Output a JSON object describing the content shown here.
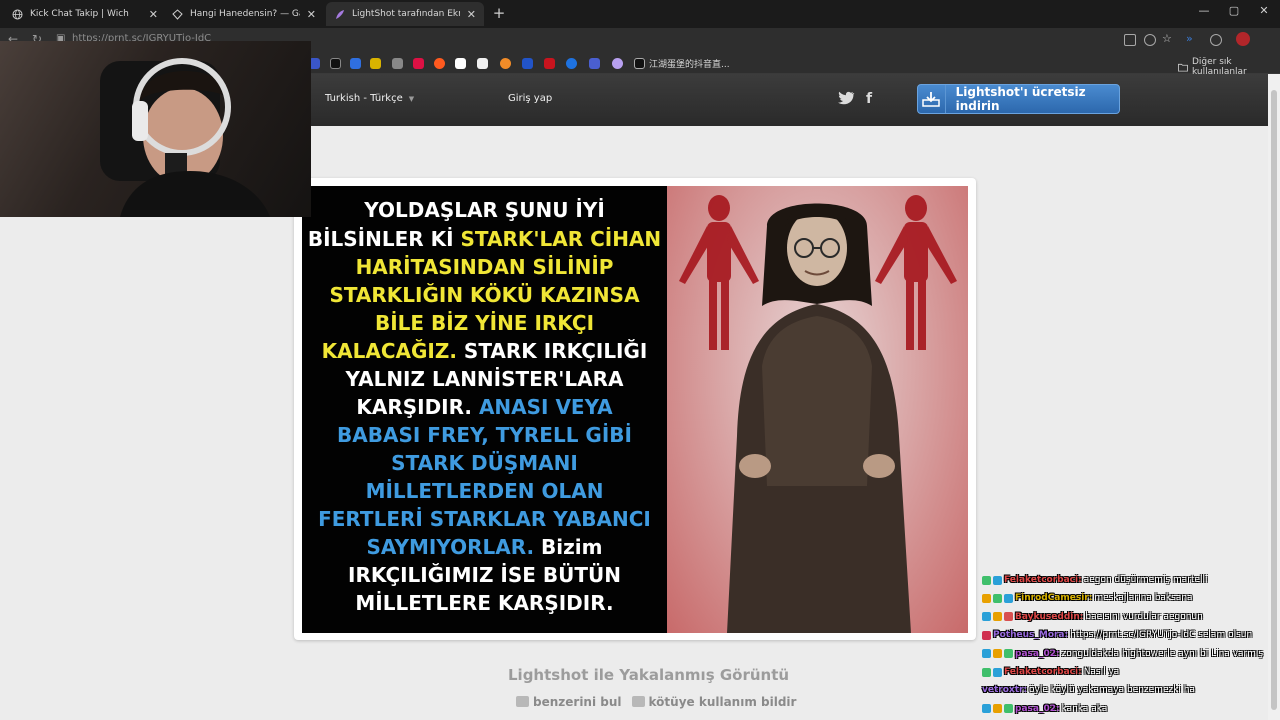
{
  "tabs": [
    {
      "title": "Kick Chat Takip | Wich",
      "close": "✕"
    },
    {
      "title": "Hangi Hanedensin? — Game of Th",
      "close": "✕"
    },
    {
      "title": "LightShot tarafından Ekran Görüntü",
      "close": "✕"
    }
  ],
  "new_tab": "+",
  "window": {
    "minimize": "—",
    "maximize": "▢",
    "close": "✕"
  },
  "address": {
    "url": "https://prnt.sc/IGRYUTjo-IdC"
  },
  "bookmarks": {
    "chinese_label": "江湖蛋堡的抖音直...",
    "other": "Diğer sık kullanılanlar"
  },
  "lightshot": {
    "language": "Turkish - Türkçe",
    "login": "Giriş yap",
    "twitter": "t",
    "facebook": "f",
    "download": "Lightshot'ı ücretsiz indirin",
    "caption": "Lightshot ile Yakalanmış Görüntü",
    "find_similar": "benzerini bul",
    "report": "kötüye kullanım bildir"
  },
  "meme": {
    "lines": [
      [
        {
          "t": "YOLDAŞLAR ŞUNU İYİ",
          "c": "w"
        }
      ],
      [
        {
          "t": "BİLSİNLER Kİ ",
          "c": "w"
        },
        {
          "t": "STARK'LAR CİHAN",
          "c": "y"
        }
      ],
      [
        {
          "t": "HARİTASINDAN SİLİNİP",
          "c": "y"
        }
      ],
      [
        {
          "t": "STARKLIĞIN KÖKÜ KAZINSA",
          "c": "y"
        }
      ],
      [
        {
          "t": "BİLE BİZ YİNE IRKÇI",
          "c": "y"
        }
      ],
      [
        {
          "t": "KALACAĞIZ. ",
          "c": "y"
        },
        {
          "t": " STARK  IRKÇILIĞI",
          "c": "w"
        }
      ],
      [
        {
          "t": "YALNIZ LANNİSTER'LARA",
          "c": "w"
        }
      ],
      [
        {
          "t": "KARŞIDIR. ",
          "c": "w"
        },
        {
          "t": "ANASI VEYA",
          "c": "b"
        }
      ],
      [
        {
          "t": "BABASI FREY, TYRELL GİBİ",
          "c": "b"
        }
      ],
      [
        {
          "t": "STARK  DÜŞMANI",
          "c": "b"
        }
      ],
      [
        {
          "t": "MİLLETLERDEN OLAN",
          "c": "b"
        }
      ],
      [
        {
          "t": "FERTLERİ  STARKLAR  YABANCI",
          "c": "b"
        }
      ],
      [
        {
          "t": "SAYMIYORLAR. ",
          "c": "b"
        },
        {
          "t": "Bizim",
          "c": "w"
        }
      ],
      [
        {
          "t": "IRKÇILIĞIMIZ İSE BÜTÜN",
          "c": "w"
        }
      ],
      [
        {
          "t": "MİLLETLERE KARŞIDIR.",
          "c": "w"
        }
      ]
    ]
  },
  "chat": [
    {
      "user": "Felaketcorbaci:",
      "color": "#e04848",
      "text": "aegon düşürmemiş martelli"
    },
    {
      "user": "FinrodCamesir:",
      "color": "#d9b300",
      "text": "meskajlarına baksana"
    },
    {
      "user": "Baykuseddin:",
      "color": "#e04848",
      "text": "baeısını vurdular aegonun"
    },
    {
      "user": "Potheus_Mora:",
      "color": "#9a6be0",
      "text": "https://prnt.sc/IGRYUTjo-IdC selam olsun"
    },
    {
      "user": "pasa_02:",
      "color": "#b050d0",
      "text": "zonguldakda hightowerle aynı bi Lina varmış"
    },
    {
      "user": "Felaketcorbaci:",
      "color": "#e04848",
      "text": "Nasıl ya"
    },
    {
      "user": "vetroxtr:",
      "color": "#9a6be0",
      "text": "öyle köylü yakamaya benzemezki ha"
    },
    {
      "user": "pasa_02:",
      "color": "#b050d0",
      "text": "kanka aka"
    }
  ]
}
